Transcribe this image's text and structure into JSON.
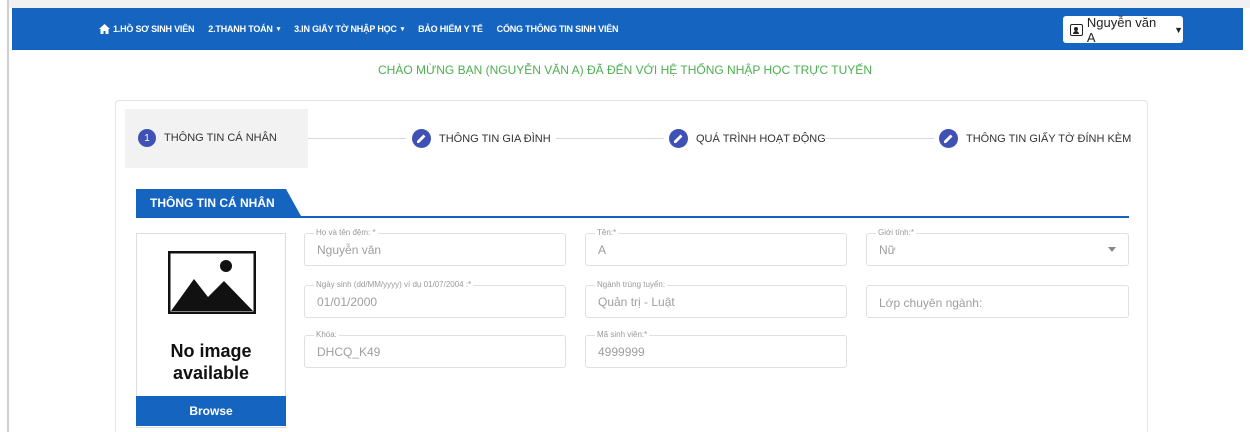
{
  "nav": {
    "items": [
      {
        "label": "1.HỒ SƠ SINH VIÊN",
        "has_caret": false,
        "icon": "home-icon"
      },
      {
        "label": "2.THANH TOÁN",
        "has_caret": true
      },
      {
        "label": "3.IN GIẤY TỜ NHẬP HỌC",
        "has_caret": true
      },
      {
        "label": "BẢO HIỂM Y TẾ",
        "has_caret": false
      },
      {
        "label": "CỔNG THÔNG TIN SINH VIÊN",
        "has_caret": false
      }
    ],
    "caret": "▾",
    "user_label": "Nguyễn văn A",
    "user_caret": "▼",
    "bg_color": "#1565c0"
  },
  "welcome": "CHÀO MỪNG BẠN (NGUYỄN VĂN A) ĐÃ ĐẾN VỚI HỆ THỐNG NHẬP HỌC TRỰC TUYẾN",
  "steps": [
    {
      "marker": "1",
      "label": "THÔNG TIN CÁ NHÂN",
      "active": true
    },
    {
      "marker": "pencil-icon",
      "label": "THÔNG TIN GIA ĐÌNH",
      "active": false
    },
    {
      "marker": "pencil-icon",
      "label": "QUÁ TRÌNH HOẠT ĐỘNG",
      "active": false
    },
    {
      "marker": "pencil-icon",
      "label": "THÔNG TIN GIẤY TỜ ĐÍNH KÈM",
      "active": false
    }
  ],
  "section": {
    "title": "THÔNG TIN CÁ NHÂN"
  },
  "photo": {
    "no_image_line1": "No image",
    "no_image_line2": "available",
    "browse_label": "Browse"
  },
  "form": {
    "ho_ten_dem": {
      "label": "Họ và tên đệm: *",
      "value": "Nguyễn văn"
    },
    "ten": {
      "label": "Tên:*",
      "value": "A"
    },
    "gioi_tinh": {
      "label": "Giới tính:*",
      "value": "Nữ"
    },
    "ngay_sinh": {
      "label": "Ngày sinh (dd/MM/yyyy) ví dụ 01/07/2004 :*",
      "value": "01/01/2000"
    },
    "nganh": {
      "label": "Ngành trúng tuyển:",
      "value": "Quản trị - Luật"
    },
    "lop": {
      "placeholder": "Lớp chuyên ngành:"
    },
    "khoa": {
      "label": "Khóa:",
      "value": "DHCQ_K49"
    },
    "msv": {
      "label": "Mã sinh viên:*",
      "value": "4999999"
    }
  },
  "colors": {
    "primary": "#1565c0",
    "step_accent": "#3f51b5",
    "welcome_green": "#4caf50"
  }
}
